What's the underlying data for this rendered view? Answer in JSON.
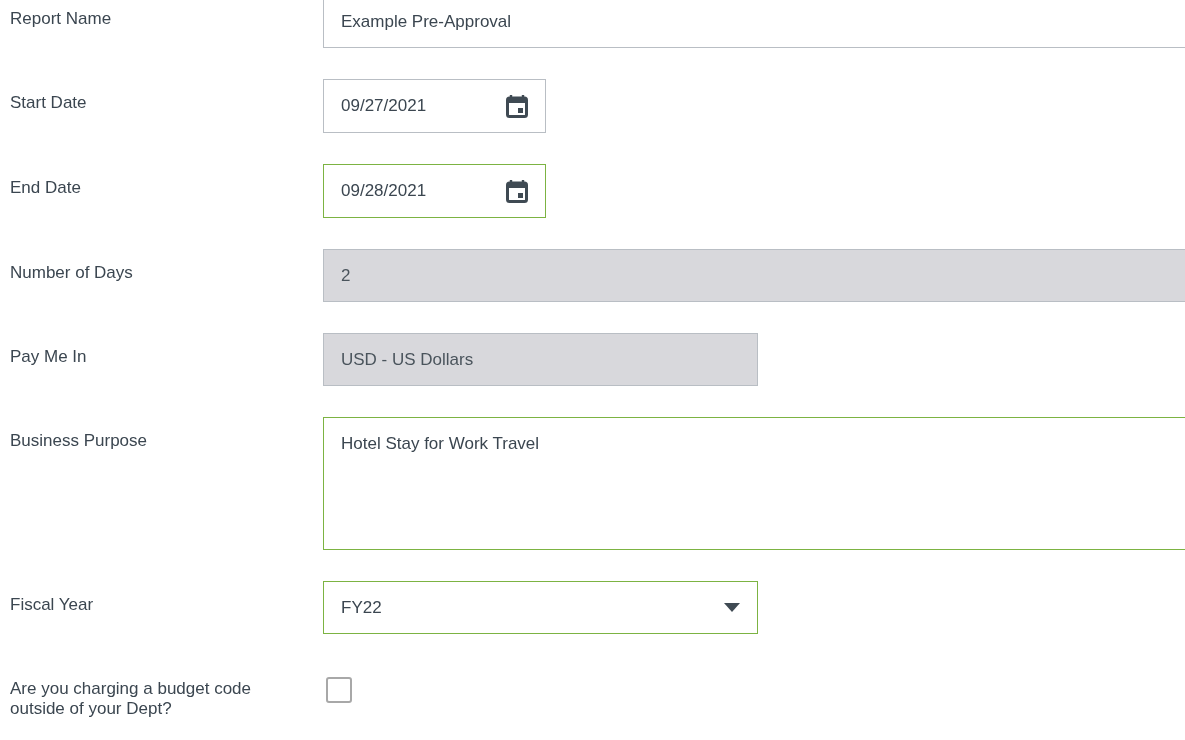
{
  "fields": [
    {
      "label": "Report Name",
      "kind": "text",
      "value": "Example Pre-Approval",
      "highlighted": false,
      "disabled": false
    },
    {
      "label": "Start Date",
      "kind": "date",
      "value": "09/27/2021",
      "highlighted": false,
      "disabled": false
    },
    {
      "label": "End Date",
      "kind": "date",
      "value": "09/28/2021",
      "highlighted": true,
      "disabled": false
    },
    {
      "label": "Number of Days",
      "kind": "text",
      "value": "2",
      "highlighted": false,
      "disabled": true
    },
    {
      "label": "Pay Me In",
      "kind": "select",
      "value": "USD - US Dollars",
      "highlighted": false,
      "disabled": true
    },
    {
      "label": "Business Purpose",
      "kind": "textarea",
      "value": "Hotel Stay for Work Travel",
      "highlighted": true,
      "disabled": false
    },
    {
      "label": "Fiscal Year",
      "kind": "select",
      "value": "FY22",
      "highlighted": true,
      "disabled": false
    },
    {
      "label": "Are you charging a budget code outside of your Dept?",
      "kind": "checkbox",
      "checked": false
    }
  ]
}
